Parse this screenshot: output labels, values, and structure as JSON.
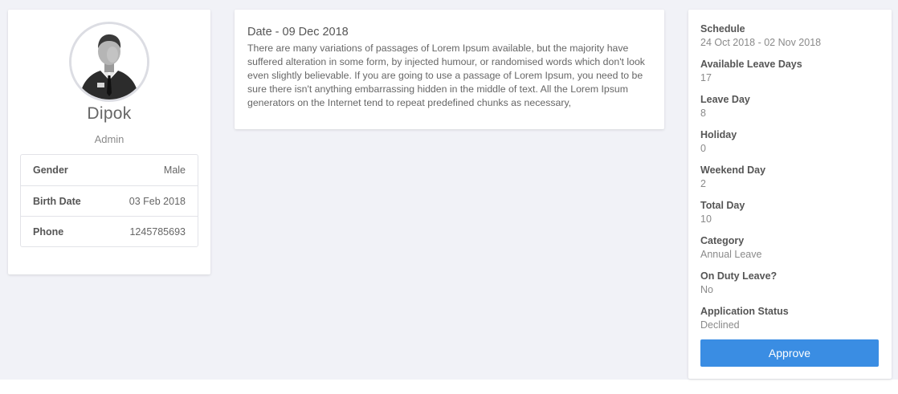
{
  "profile": {
    "name": "Dipok",
    "role": "Admin",
    "info": [
      {
        "label": "Gender",
        "value": "Male"
      },
      {
        "label": "Birth Date",
        "value": "03 Feb 2018"
      },
      {
        "label": "Phone",
        "value": "1245785693"
      }
    ]
  },
  "message": {
    "date": "Date - 09 Dec 2018",
    "body": "There are many variations of passages of Lorem Ipsum available, but the majority have suffered alteration in some form, by injected humour, or randomised words which don't look even slightly believable. If you are going to use a passage of Lorem Ipsum, you need to be sure there isn't anything embarrassing hidden in the middle of text. All the Lorem Ipsum generators on the Internet tend to repeat predefined chunks as necessary,"
  },
  "details": [
    {
      "label": "Schedule",
      "value": "24 Oct 2018 - 02 Nov 2018"
    },
    {
      "label": "Available Leave Days",
      "value": "17"
    },
    {
      "label": "Leave Day",
      "value": "8"
    },
    {
      "label": "Holiday",
      "value": "0"
    },
    {
      "label": "Weekend Day",
      "value": "2"
    },
    {
      "label": "Total Day",
      "value": "10"
    },
    {
      "label": "Category",
      "value": "Annual Leave"
    },
    {
      "label": "On Duty Leave?",
      "value": "No"
    },
    {
      "label": "Application Status",
      "value": "Declined"
    }
  ],
  "actions": {
    "approve_label": "Approve"
  },
  "colors": {
    "background": "#f1f2f7",
    "card": "#ffffff",
    "primary_button": "#3a8de3"
  },
  "icons": {
    "avatar": "user-avatar-businessman"
  }
}
